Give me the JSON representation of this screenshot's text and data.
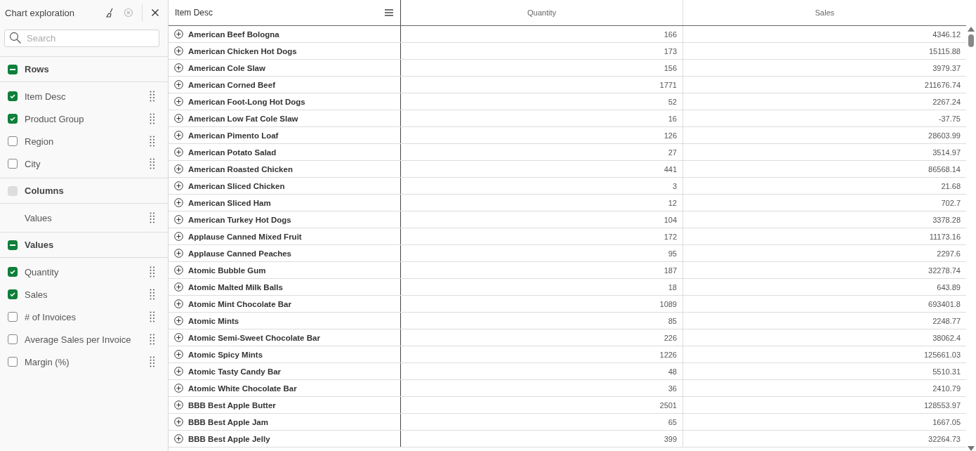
{
  "panel": {
    "title": "Chart exploration",
    "search": {
      "placeholder": "Search"
    },
    "sections": [
      {
        "label": "Rows",
        "checked": true,
        "disabled": false,
        "items": [
          {
            "kind": "checkbox",
            "label": "Item Desc",
            "checked": true
          },
          {
            "kind": "checkbox",
            "label": "Product Group",
            "checked": true
          },
          {
            "kind": "checkbox",
            "label": "Region",
            "checked": false
          },
          {
            "kind": "checkbox",
            "label": "City",
            "checked": false
          }
        ]
      },
      {
        "label": "Columns",
        "checked": false,
        "disabled": true,
        "items": [
          {
            "kind": "plain",
            "label": "Values"
          }
        ]
      },
      {
        "label": "Values",
        "checked": true,
        "disabled": false,
        "items": [
          {
            "kind": "checkbox",
            "label": "Quantity",
            "checked": true
          },
          {
            "kind": "checkbox",
            "label": "Sales",
            "checked": true
          },
          {
            "kind": "checkbox",
            "label": "# of Invoices",
            "checked": false
          },
          {
            "kind": "checkbox",
            "label": "Average Sales per Invoice",
            "checked": false
          },
          {
            "kind": "checkbox",
            "label": "Margin (%)",
            "checked": false
          }
        ]
      }
    ]
  },
  "table": {
    "columns": [
      "Item Desc",
      "Quantity",
      "Sales"
    ],
    "rows": [
      [
        "American Beef Bologna",
        "166",
        "4346.12"
      ],
      [
        "American Chicken Hot Dogs",
        "173",
        "15115.88"
      ],
      [
        "American Cole Slaw",
        "156",
        "3979.37"
      ],
      [
        "American Corned Beef",
        "1771",
        "211676.74"
      ],
      [
        "American Foot-Long Hot Dogs",
        "52",
        "2267.24"
      ],
      [
        "American Low Fat Cole Slaw",
        "16",
        "-37.75"
      ],
      [
        "American Pimento Loaf",
        "126",
        "28603.99"
      ],
      [
        "American Potato Salad",
        "27",
        "3514.97"
      ],
      [
        "American Roasted Chicken",
        "441",
        "86568.14"
      ],
      [
        "American Sliced Chicken",
        "3",
        "21.68"
      ],
      [
        "American Sliced Ham",
        "12",
        "702.7"
      ],
      [
        "American Turkey Hot Dogs",
        "104",
        "3378.28"
      ],
      [
        "Applause Canned Mixed Fruit",
        "172",
        "11173.16"
      ],
      [
        "Applause Canned Peaches",
        "95",
        "2297.6"
      ],
      [
        "Atomic Bubble Gum",
        "187",
        "32278.74"
      ],
      [
        "Atomic Malted Milk Balls",
        "18",
        "643.89"
      ],
      [
        "Atomic Mint Chocolate Bar",
        "1089",
        "693401.8"
      ],
      [
        "Atomic Mints",
        "85",
        "2248.77"
      ],
      [
        "Atomic Semi-Sweet Chocolate Bar",
        "226",
        "38062.4"
      ],
      [
        "Atomic Spicy Mints",
        "1226",
        "125661.03"
      ],
      [
        "Atomic Tasty Candy Bar",
        "48",
        "5510.31"
      ],
      [
        "Atomic White Chocolate Bar",
        "36",
        "2410.79"
      ],
      [
        "BBB Best Apple Butter",
        "2501",
        "128553.97"
      ],
      [
        "BBB Best Apple Jam",
        "65",
        "1667.05"
      ],
      [
        "BBB Best Apple Jelly",
        "399",
        "32264.73"
      ]
    ]
  }
}
